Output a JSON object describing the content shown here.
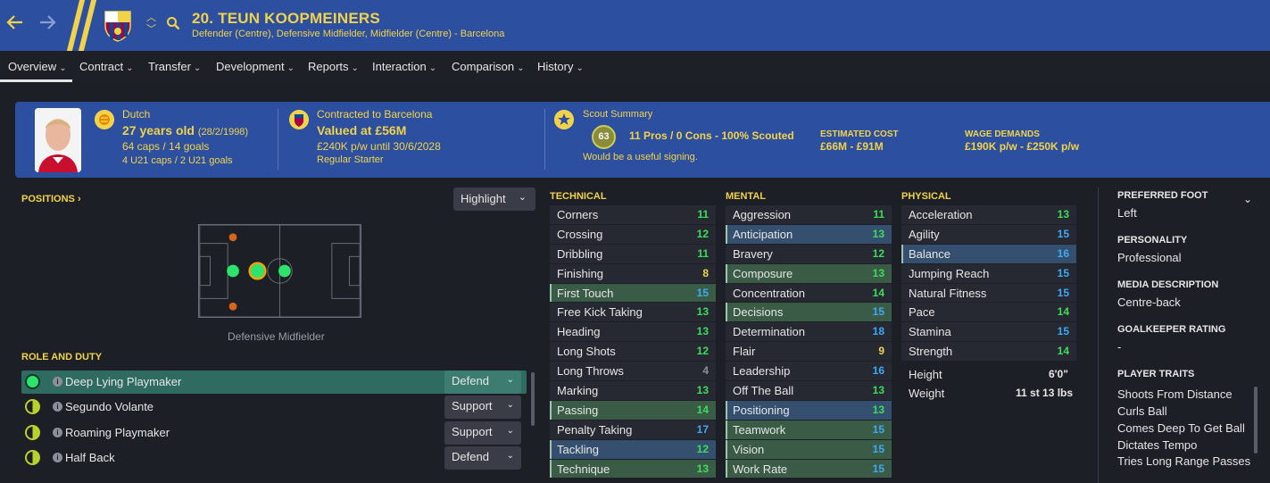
{
  "header": {
    "title": "20. TEUN KOOPMEINERS",
    "subtitle": "Defender (Centre), Defensive Midfielder, Midfielder (Centre) - Barcelona",
    "back_icon": "arrow-left-icon",
    "forward_icon": "arrow-right-icon",
    "accent": "#f1d34b",
    "bar_color": "#2d4fa0"
  },
  "tabs": [
    {
      "label": "Overview"
    },
    {
      "label": "Contract"
    },
    {
      "label": "Transfer"
    },
    {
      "label": "Development"
    },
    {
      "label": "Reports"
    },
    {
      "label": "Interaction"
    },
    {
      "label": "Comparison"
    },
    {
      "label": "History"
    }
  ],
  "banner": {
    "nationality": "Dutch",
    "age": "27 years old",
    "dob": "(28/2/1998)",
    "caps": "64 caps / 14 goals",
    "u21_caps": "4 U21 caps / 2 U21 goals",
    "contract_label": "Contracted to Barcelona",
    "value": "Valued at £56M",
    "wage": "£240K p/w until 30/6/2028",
    "status": "Regular Starter",
    "scout_label": "Scout Summary",
    "scout_rating": "63",
    "scout_line": "11 Pros / 0 Cons - 100% Scouted",
    "scout_note": "Would be a useful signing.",
    "cost_label": "ESTIMATED COST",
    "cost_value": "£66M - £91M",
    "wage_label": "WAGE DEMANDS",
    "wage_value": "£190K p/w - £250K p/w"
  },
  "positions": {
    "heading": "POSITIONS",
    "highlight_label": "Highlight",
    "pitch_label": "Defensive Midfielder"
  },
  "roles": {
    "heading": "ROLE AND DUTY",
    "items": [
      {
        "name": "Deep Lying Playmaker",
        "duty": "Defend",
        "selected": true
      },
      {
        "name": "Segundo Volante",
        "duty": "Support",
        "selected": false
      },
      {
        "name": "Roaming Playmaker",
        "duty": "Support",
        "selected": false
      },
      {
        "name": "Half Back",
        "duty": "Defend",
        "selected": false
      }
    ]
  },
  "technical": {
    "heading": "TECHNICAL",
    "items": [
      {
        "name": "Corners",
        "value": "11",
        "hl": ""
      },
      {
        "name": "Crossing",
        "value": "12",
        "hl": ""
      },
      {
        "name": "Dribbling",
        "value": "11",
        "hl": ""
      },
      {
        "name": "Finishing",
        "value": "8",
        "hl": ""
      },
      {
        "name": "First Touch",
        "value": "15",
        "hl": "green"
      },
      {
        "name": "Free Kick Taking",
        "value": "13",
        "hl": ""
      },
      {
        "name": "Heading",
        "value": "13",
        "hl": ""
      },
      {
        "name": "Long Shots",
        "value": "12",
        "hl": ""
      },
      {
        "name": "Long Throws",
        "value": "4",
        "hl": ""
      },
      {
        "name": "Marking",
        "value": "13",
        "hl": ""
      },
      {
        "name": "Passing",
        "value": "14",
        "hl": "green"
      },
      {
        "name": "Penalty Taking",
        "value": "17",
        "hl": ""
      },
      {
        "name": "Tackling",
        "value": "12",
        "hl": "blue"
      },
      {
        "name": "Technique",
        "value": "13",
        "hl": "green"
      }
    ]
  },
  "mental": {
    "heading": "MENTAL",
    "items": [
      {
        "name": "Aggression",
        "value": "11",
        "hl": ""
      },
      {
        "name": "Anticipation",
        "value": "13",
        "hl": "blue"
      },
      {
        "name": "Bravery",
        "value": "12",
        "hl": ""
      },
      {
        "name": "Composure",
        "value": "13",
        "hl": "green"
      },
      {
        "name": "Concentration",
        "value": "14",
        "hl": ""
      },
      {
        "name": "Decisions",
        "value": "15",
        "hl": "green"
      },
      {
        "name": "Determination",
        "value": "18",
        "hl": ""
      },
      {
        "name": "Flair",
        "value": "9",
        "hl": ""
      },
      {
        "name": "Leadership",
        "value": "16",
        "hl": ""
      },
      {
        "name": "Off The Ball",
        "value": "13",
        "hl": ""
      },
      {
        "name": "Positioning",
        "value": "13",
        "hl": "blue"
      },
      {
        "name": "Teamwork",
        "value": "15",
        "hl": "green"
      },
      {
        "name": "Vision",
        "value": "15",
        "hl": "green"
      },
      {
        "name": "Work Rate",
        "value": "15",
        "hl": "green"
      }
    ]
  },
  "physical": {
    "heading": "PHYSICAL",
    "items": [
      {
        "name": "Acceleration",
        "value": "13",
        "hl": ""
      },
      {
        "name": "Agility",
        "value": "15",
        "hl": ""
      },
      {
        "name": "Balance",
        "value": "16",
        "hl": "blue"
      },
      {
        "name": "Jumping Reach",
        "value": "15",
        "hl": ""
      },
      {
        "name": "Natural Fitness",
        "value": "15",
        "hl": ""
      },
      {
        "name": "Pace",
        "value": "14",
        "hl": ""
      },
      {
        "name": "Stamina",
        "value": "15",
        "hl": ""
      },
      {
        "name": "Strength",
        "value": "14",
        "hl": ""
      }
    ],
    "height_label": "Height",
    "height_value": "6'0\"",
    "weight_label": "Weight",
    "weight_value": "11 st 13 lbs"
  },
  "side": {
    "foot_label": "PREFERRED FOOT",
    "foot_value": "Left",
    "personality_label": "PERSONALITY",
    "personality_value": "Professional",
    "media_label": "MEDIA DESCRIPTION",
    "media_value": "Centre-back",
    "gk_label": "GOALKEEPER RATING",
    "gk_value": "-",
    "traits_label": "PLAYER TRAITS",
    "traits": [
      "Shoots From Distance",
      "Curls Ball",
      "Comes Deep To Get Ball",
      "Dictates Tempo",
      "Tries Long Range Passes"
    ]
  }
}
